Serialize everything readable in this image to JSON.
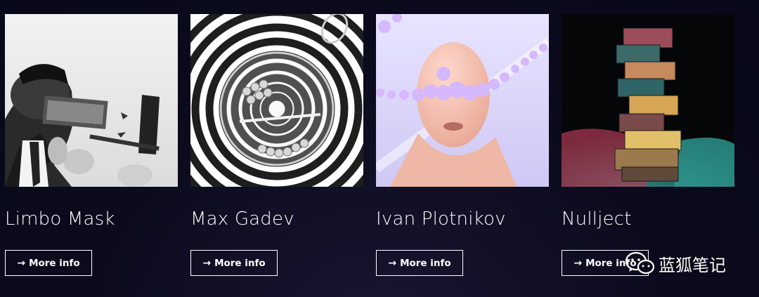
{
  "artists": [
    {
      "name": "Limbo Mask",
      "button_label": "More info",
      "icon": "arrow-right-icon"
    },
    {
      "name": "Max Gadev",
      "button_label": "More info",
      "icon": "arrow-right-icon"
    },
    {
      "name": "Ivan Plotnikov",
      "button_label": "More info",
      "icon": "arrow-right-icon"
    },
    {
      "name": "Nullject",
      "button_label": "More info",
      "icon": "arrow-right-icon"
    }
  ],
  "watermark": {
    "text": "蓝狐笔记",
    "icon": "wechat-icon"
  },
  "colors": {
    "background": "#0b0b1d",
    "text": "#ffffff",
    "button_border": "#ffffff"
  }
}
